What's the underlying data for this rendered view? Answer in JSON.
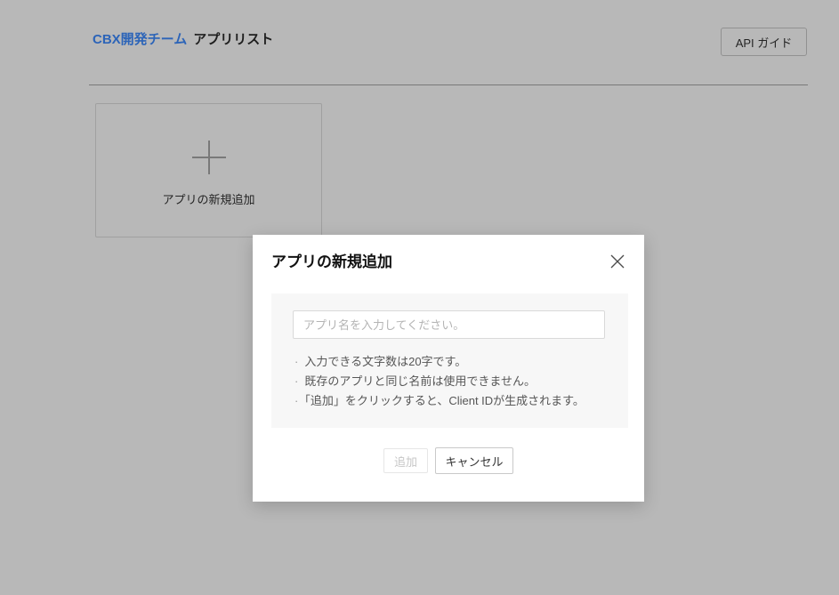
{
  "header": {
    "team_name": "CBX開発チーム",
    "page_title": "アプリリスト",
    "api_guide_button": "API ガイド"
  },
  "app_list": {
    "add_app_card_label": "アプリの新規追加"
  },
  "modal": {
    "title": "アプリの新規追加",
    "name_input": {
      "value": "",
      "placeholder": "アプリ名を入力してください。"
    },
    "bullet": "·",
    "notes": [
      "入力できる文字数は20字です。",
      "既存のアプリと同じ名前は使用できません。",
      "「追加」をクリックすると、Client IDが生成されます。"
    ],
    "add_button": "追加",
    "cancel_button": "キャンセル"
  },
  "colors": {
    "link_blue": "#3d8bff",
    "overlay": "rgba(0, 0, 0, 0.28)",
    "modal_section_bg": "#f7f7f7"
  }
}
